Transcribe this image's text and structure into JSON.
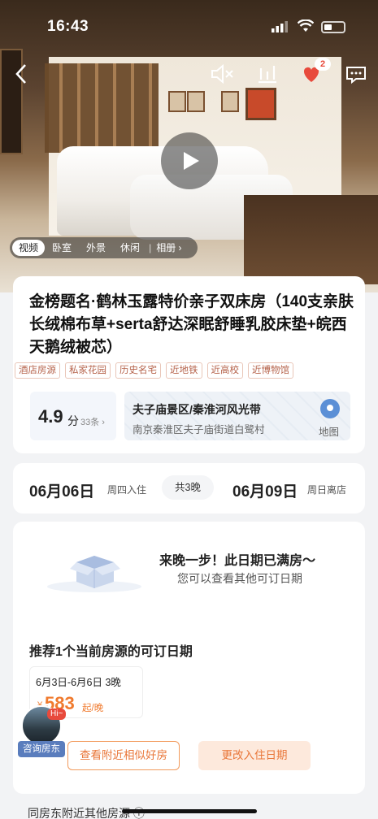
{
  "status_bar": {
    "time": "16:43"
  },
  "toolbar": {
    "notification_count": "2"
  },
  "media_tabs": [
    {
      "label": "视频"
    },
    {
      "label": "卧室"
    },
    {
      "label": "外景"
    },
    {
      "label": "休闲"
    },
    {
      "label": "相册 ›"
    }
  ],
  "listing": {
    "title": "金榜题名·鹤林玉露特价亲子双床房（140支亲肤长绒棉布草+serta舒达深眠舒睡乳胶床垫+皖西天鹅绒被芯）",
    "tags": [
      "酒店房源",
      "私家花园",
      "历史名宅",
      "近地铁",
      "近高校",
      "近博物馆"
    ],
    "rating": {
      "score": "4.9",
      "unit": "分",
      "count": "33条 ›"
    },
    "location": {
      "area": "夫子庙景区/秦淮河风光带",
      "address": "南京秦淮区夫子庙街道白鹭村",
      "map_label": "地图"
    }
  },
  "dates": {
    "checkin_date": "06月06日",
    "checkin_label": "周四入住",
    "nights": "共3晚",
    "checkout_date": "06月09日",
    "checkout_label": "周日离店"
  },
  "availability": {
    "headline": "来晚一步！此日期已满房～",
    "subline": "您可以查看其他可订日期",
    "recommend_title": "推荐1个当前房源的可订日期",
    "option": {
      "range": "6月3日-6月6日  3晚",
      "currency": "¥",
      "price": "583",
      "unit": "起/晚"
    },
    "btn_nearby": "查看附近相似好房",
    "btn_change": "更改入住日期"
  },
  "host": {
    "hi": "Hi~",
    "label": "咨询房东"
  },
  "footer": {
    "section_title": "同房东附近其他房源 ⓘ"
  },
  "colors": {
    "accent": "#f07a2e",
    "brand_blue": "#5a7dbd"
  }
}
